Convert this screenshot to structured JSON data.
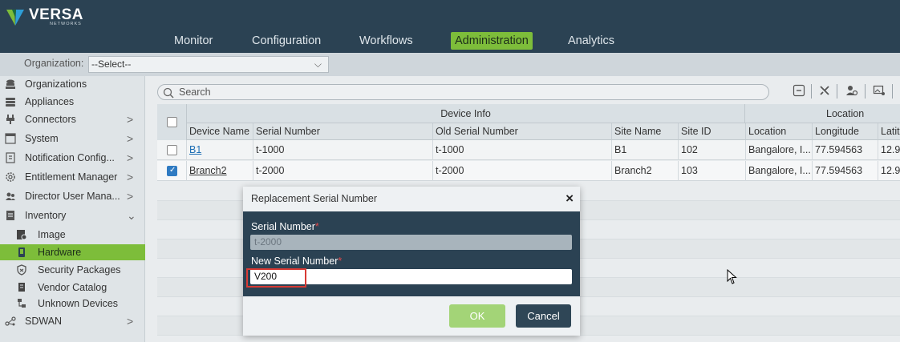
{
  "brand": {
    "name": "VERSA",
    "sub": "NETWORKS"
  },
  "nav": [
    {
      "label": "Monitor",
      "active": false
    },
    {
      "label": "Configuration",
      "active": false
    },
    {
      "label": "Workflows",
      "active": false
    },
    {
      "label": "Administration",
      "active": true
    },
    {
      "label": "Analytics",
      "active": false
    }
  ],
  "org": {
    "label": "Organization:",
    "value": "--Select--"
  },
  "sidebar": {
    "items": [
      {
        "label": "Organizations",
        "icon": "organizations-icon"
      },
      {
        "label": "Appliances",
        "icon": "appliances-icon"
      },
      {
        "label": "Connectors",
        "icon": "connectors-icon",
        "arrow": ">"
      },
      {
        "label": "System",
        "icon": "system-icon",
        "arrow": ">"
      },
      {
        "label": "Notification Config...",
        "icon": "notification-icon",
        "arrow": ">"
      },
      {
        "label": "Entitlement Manager",
        "icon": "gear-icon",
        "arrow": ">"
      },
      {
        "label": "Director User Mana...",
        "icon": "users-icon",
        "arrow": ">"
      },
      {
        "label": "Inventory",
        "icon": "inventory-icon",
        "arrow": "⌄"
      },
      {
        "label": "Image",
        "icon": "image-icon",
        "sub": true
      },
      {
        "label": "Hardware",
        "icon": "hardware-icon",
        "sub": true,
        "selected": true
      },
      {
        "label": "Security Packages",
        "icon": "shield-icon",
        "sub": true
      },
      {
        "label": "Vendor Catalog",
        "icon": "catalog-icon",
        "sub": true
      },
      {
        "label": "Unknown Devices",
        "icon": "unknown-devices-icon",
        "sub": true
      },
      {
        "label": "SDWAN",
        "icon": "sdwan-icon",
        "arrow": ">"
      }
    ]
  },
  "search": {
    "placeholder": "Search"
  },
  "table": {
    "groups": {
      "device_info": "Device Info",
      "location": "Location"
    },
    "columns": [
      "Device Name",
      "Serial Number",
      "Old Serial Number",
      "Site Name",
      "Site ID",
      "Location",
      "Longitude",
      "Latit"
    ],
    "rows": [
      {
        "checked": false,
        "device_name": "B1",
        "serial": "t-1000",
        "old_serial": "t-1000",
        "site_name": "B1",
        "site_id": "102",
        "location": "Bangalore, I...",
        "longitude": "77.594563",
        "latitude": "12.9"
      },
      {
        "checked": true,
        "device_name": "Branch2",
        "serial": "t-2000",
        "old_serial": "t-2000",
        "site_name": "Branch2",
        "site_id": "103",
        "location": "Bangalore, I...",
        "longitude": "77.594563",
        "latitude": "12.9"
      }
    ]
  },
  "modal": {
    "title": "Replacement Serial Number",
    "close": "×",
    "serial_label": "Serial Number",
    "serial_value": "t-2000",
    "new_serial_label": "New Serial Number",
    "new_serial_value": "V200",
    "required_mark": "*",
    "ok": "OK",
    "cancel": "Cancel"
  },
  "colors": {
    "header_bg": "#2b4253",
    "accent": "#7dbd3a",
    "link": "#1f6fb5",
    "required": "#e0484a"
  }
}
